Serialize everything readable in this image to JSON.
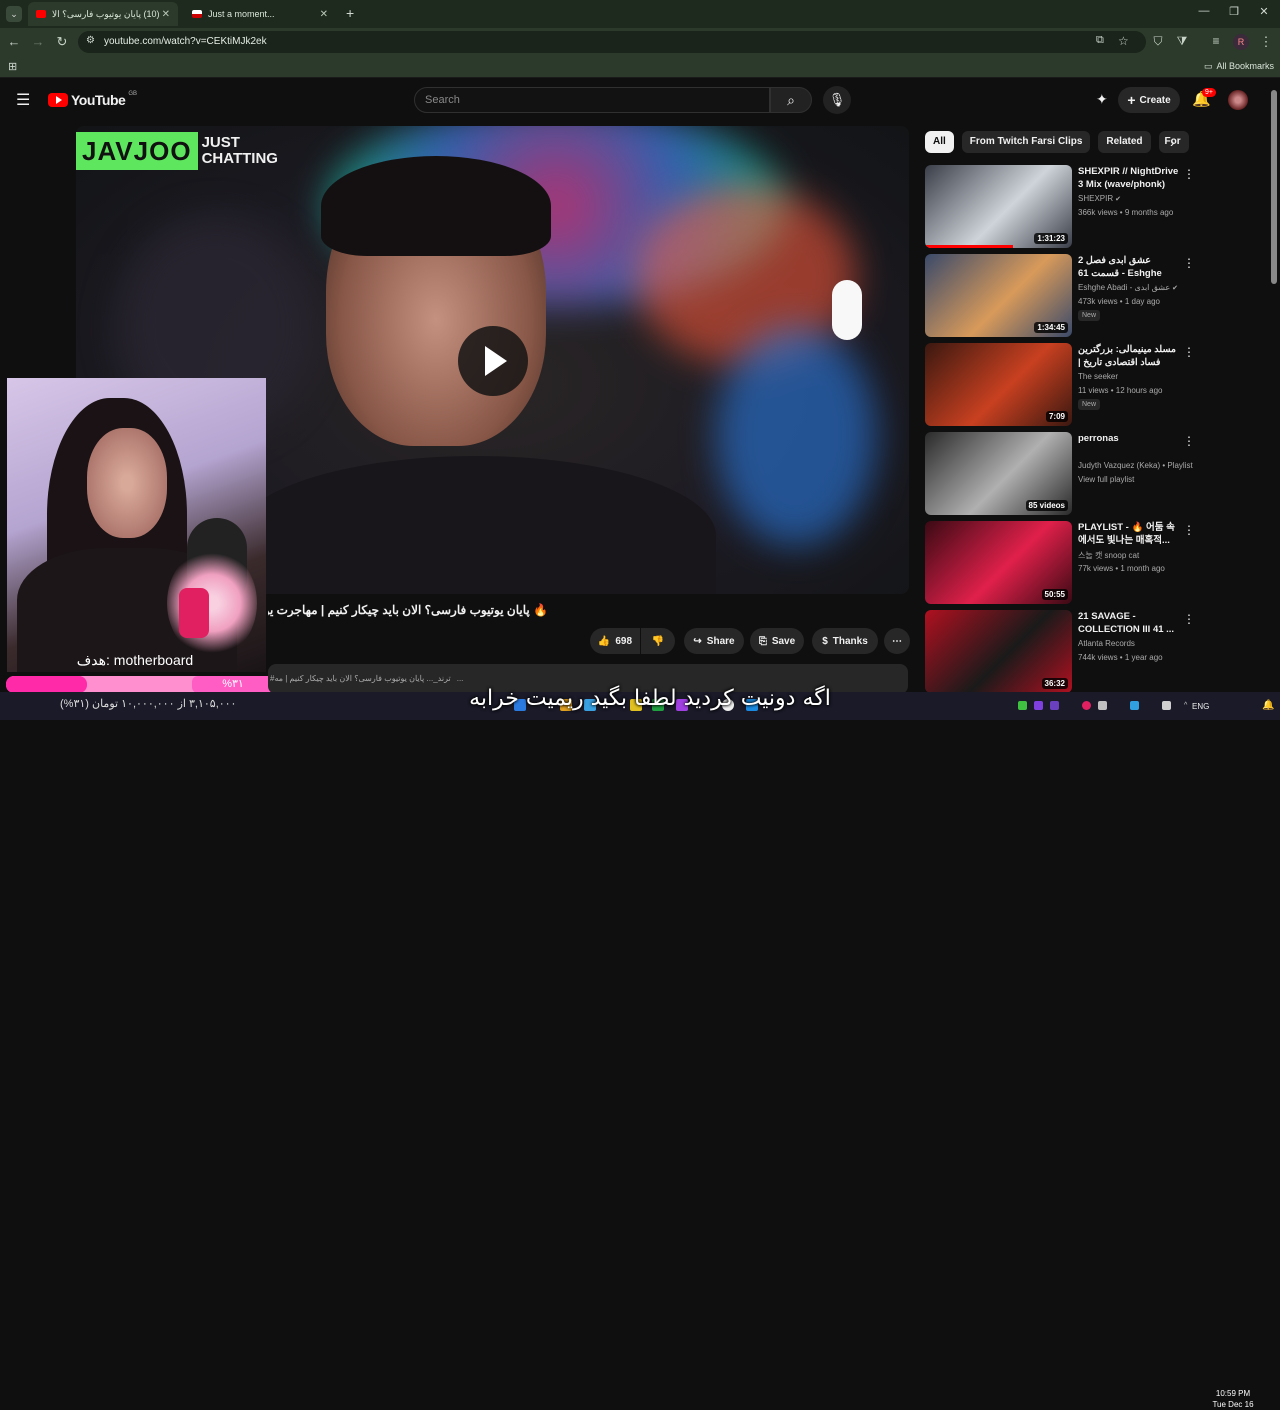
{
  "browser": {
    "tabs": [
      {
        "title": "(10) پایان یوتیوب فارسی؟ الا",
        "active": true
      },
      {
        "title": "Just a moment...",
        "active": false
      }
    ],
    "new_tab": "+",
    "url": "youtube.com/watch?v=CEKtiMJk2ek",
    "bookmarks_label": "All Bookmarks",
    "profile_initial": "R"
  },
  "youtube": {
    "logo_text": "YouTube",
    "region": "GB",
    "search_placeholder": "Search",
    "create_label": "Create",
    "notif_count": "9+"
  },
  "video": {
    "overlay_logo_green": "JAVJOO",
    "overlay_logo_white_1": "JUST",
    "overlay_logo_white_2": "CHATTING",
    "title": "پایان یوتیوب فارسی؟ الان باید چیکار کنیم | مهاجرت یوتیوبرا",
    "like_count": "698",
    "share_label": "Share",
    "save_label": "Save",
    "thanks_label": "Thanks",
    "desc_hashtag": "#ترند_...",
    "desc_snippet": "پایان یوتیوب فارسی؟ الان باید چیکار کنیم | مه..."
  },
  "stream_overlay": {
    "goal_text": "هدف: motherboard",
    "goal_percent": "%۳۱",
    "goal_fraction": 0.31,
    "donation_text": "۳,۱۰۵,۰۰۰ از ۱۰,۰۰۰,۰۰۰ تومان (۳۱%)",
    "subtitle": "اگه دونیت کردید لطفا بگید ریمیت خرابه"
  },
  "sidebar": {
    "chips": [
      "All",
      "From Twitch Farsi Clips",
      "Related",
      "For"
    ],
    "items": [
      {
        "title": "SHEXPIR // NightDrive 3 Mix (wave/phonk)",
        "channel": "SHEXPIR",
        "verified": true,
        "meta": "366k views • 9 months ago",
        "duration": "1:31:23",
        "badge": "",
        "thumb": "#3a3e48",
        "thumb2": "#cfd4da"
      },
      {
        "title": "عشق ابدی فصل 2 قسمت 61 - Eshghe Abadi",
        "channel": "Eshghe Abadi - عشق ابدی",
        "verified": true,
        "meta": "473k views • 1 day ago",
        "duration": "1:34:45",
        "badge": "New",
        "thumb": "#3a4a6a",
        "thumb2": "#d89a5a"
      },
      {
        "title": "مسلد مینیمالی: بزرگترین فساد اقتصادی تاریخ | داستان...",
        "channel": "The seeker",
        "verified": false,
        "meta": "11 views • 12 hours ago",
        "duration": "7:09",
        "badge": "New",
        "thumb": "#3a1810",
        "thumb2": "#c84020"
      },
      {
        "title": "perronas",
        "channel": "Judyth Vazquez (Keka) • Playlist",
        "verified": false,
        "meta": "View full playlist",
        "duration": "85 videos",
        "badge": "",
        "thumb": "#2a2a2a",
        "thumb2": "#b0b0b0"
      },
      {
        "title": "PLAYLIST - 🔥 어둠 속에서도 빛나는 매혹적...",
        "channel": "스눕 캣 snoop cat",
        "verified": false,
        "meta": "77k views • 1 month ago",
        "duration": "50:55",
        "badge": "",
        "thumb": "#3a0a14",
        "thumb2": "#e0204a"
      },
      {
        "title": "21 SAVAGE - COLLECTION III 41 ...",
        "channel": "Atlanta Records",
        "verified": false,
        "meta": "744k views • 1 year ago",
        "duration": "36:32",
        "badge": "",
        "thumb": "#b01020",
        "thumb2": "#1a1a1a"
      }
    ]
  },
  "taskbar": {
    "lang": "ENG",
    "time": "10:59 PM",
    "date": "Tue Dec 16"
  },
  "colors": {
    "accent": "#ff0000",
    "goal_pink": "#ff2aa8"
  }
}
